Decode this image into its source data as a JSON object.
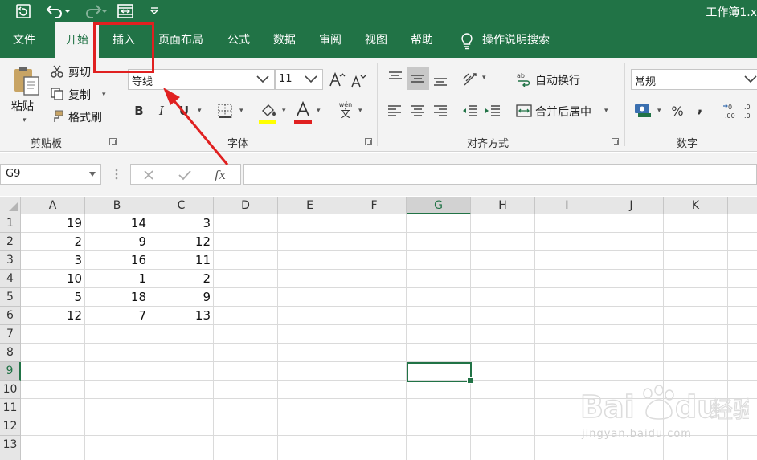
{
  "app": {
    "doc_title": "工作簿1.x",
    "accent": "#217346"
  },
  "tabs": [
    {
      "label": "文件",
      "active": false
    },
    {
      "label": "开始",
      "active": true
    },
    {
      "label": "插入",
      "active": false
    },
    {
      "label": "页面布局",
      "active": false
    },
    {
      "label": "公式",
      "active": false
    },
    {
      "label": "数据",
      "active": false
    },
    {
      "label": "审阅",
      "active": false
    },
    {
      "label": "视图",
      "active": false
    },
    {
      "label": "帮助",
      "active": false
    }
  ],
  "tell_me": "操作说明搜索",
  "ribbon": {
    "clipboard": {
      "paste": "粘贴",
      "cut": "剪切",
      "copy": "复制",
      "format_painter": "格式刷",
      "label": "剪贴板"
    },
    "font": {
      "name": "等线",
      "size": "11",
      "bold": "B",
      "italic": "I",
      "underline": "U",
      "phonetic_top": "wén",
      "phonetic_bottom": "文",
      "label": "字体",
      "fill_color": "#ffff00",
      "font_color": "#e02020"
    },
    "alignment": {
      "wrap_text": "自动换行",
      "merge_center": "合并后居中",
      "label": "对齐方式"
    },
    "number": {
      "format": "常规",
      "percent": "%",
      "comma": ",",
      "label": "数字"
    }
  },
  "formula_bar": {
    "name_box": "G9",
    "value": ""
  },
  "sheet": {
    "columns": [
      "A",
      "B",
      "C",
      "D",
      "E",
      "F",
      "G",
      "H",
      "I",
      "J",
      "K"
    ],
    "rows": [
      "1",
      "2",
      "3",
      "4",
      "5",
      "6",
      "7",
      "8",
      "9",
      "10",
      "11",
      "12",
      "13"
    ],
    "selected_column": "G",
    "selected_row": "9",
    "data": [
      [
        "19",
        "14",
        "3"
      ],
      [
        "2",
        "9",
        "12"
      ],
      [
        "3",
        "16",
        "11"
      ],
      [
        "10",
        "1",
        "2"
      ],
      [
        "5",
        "18",
        "9"
      ],
      [
        "12",
        "7",
        "13"
      ]
    ]
  },
  "watermark": {
    "url": "jingyan.baidu.com"
  }
}
